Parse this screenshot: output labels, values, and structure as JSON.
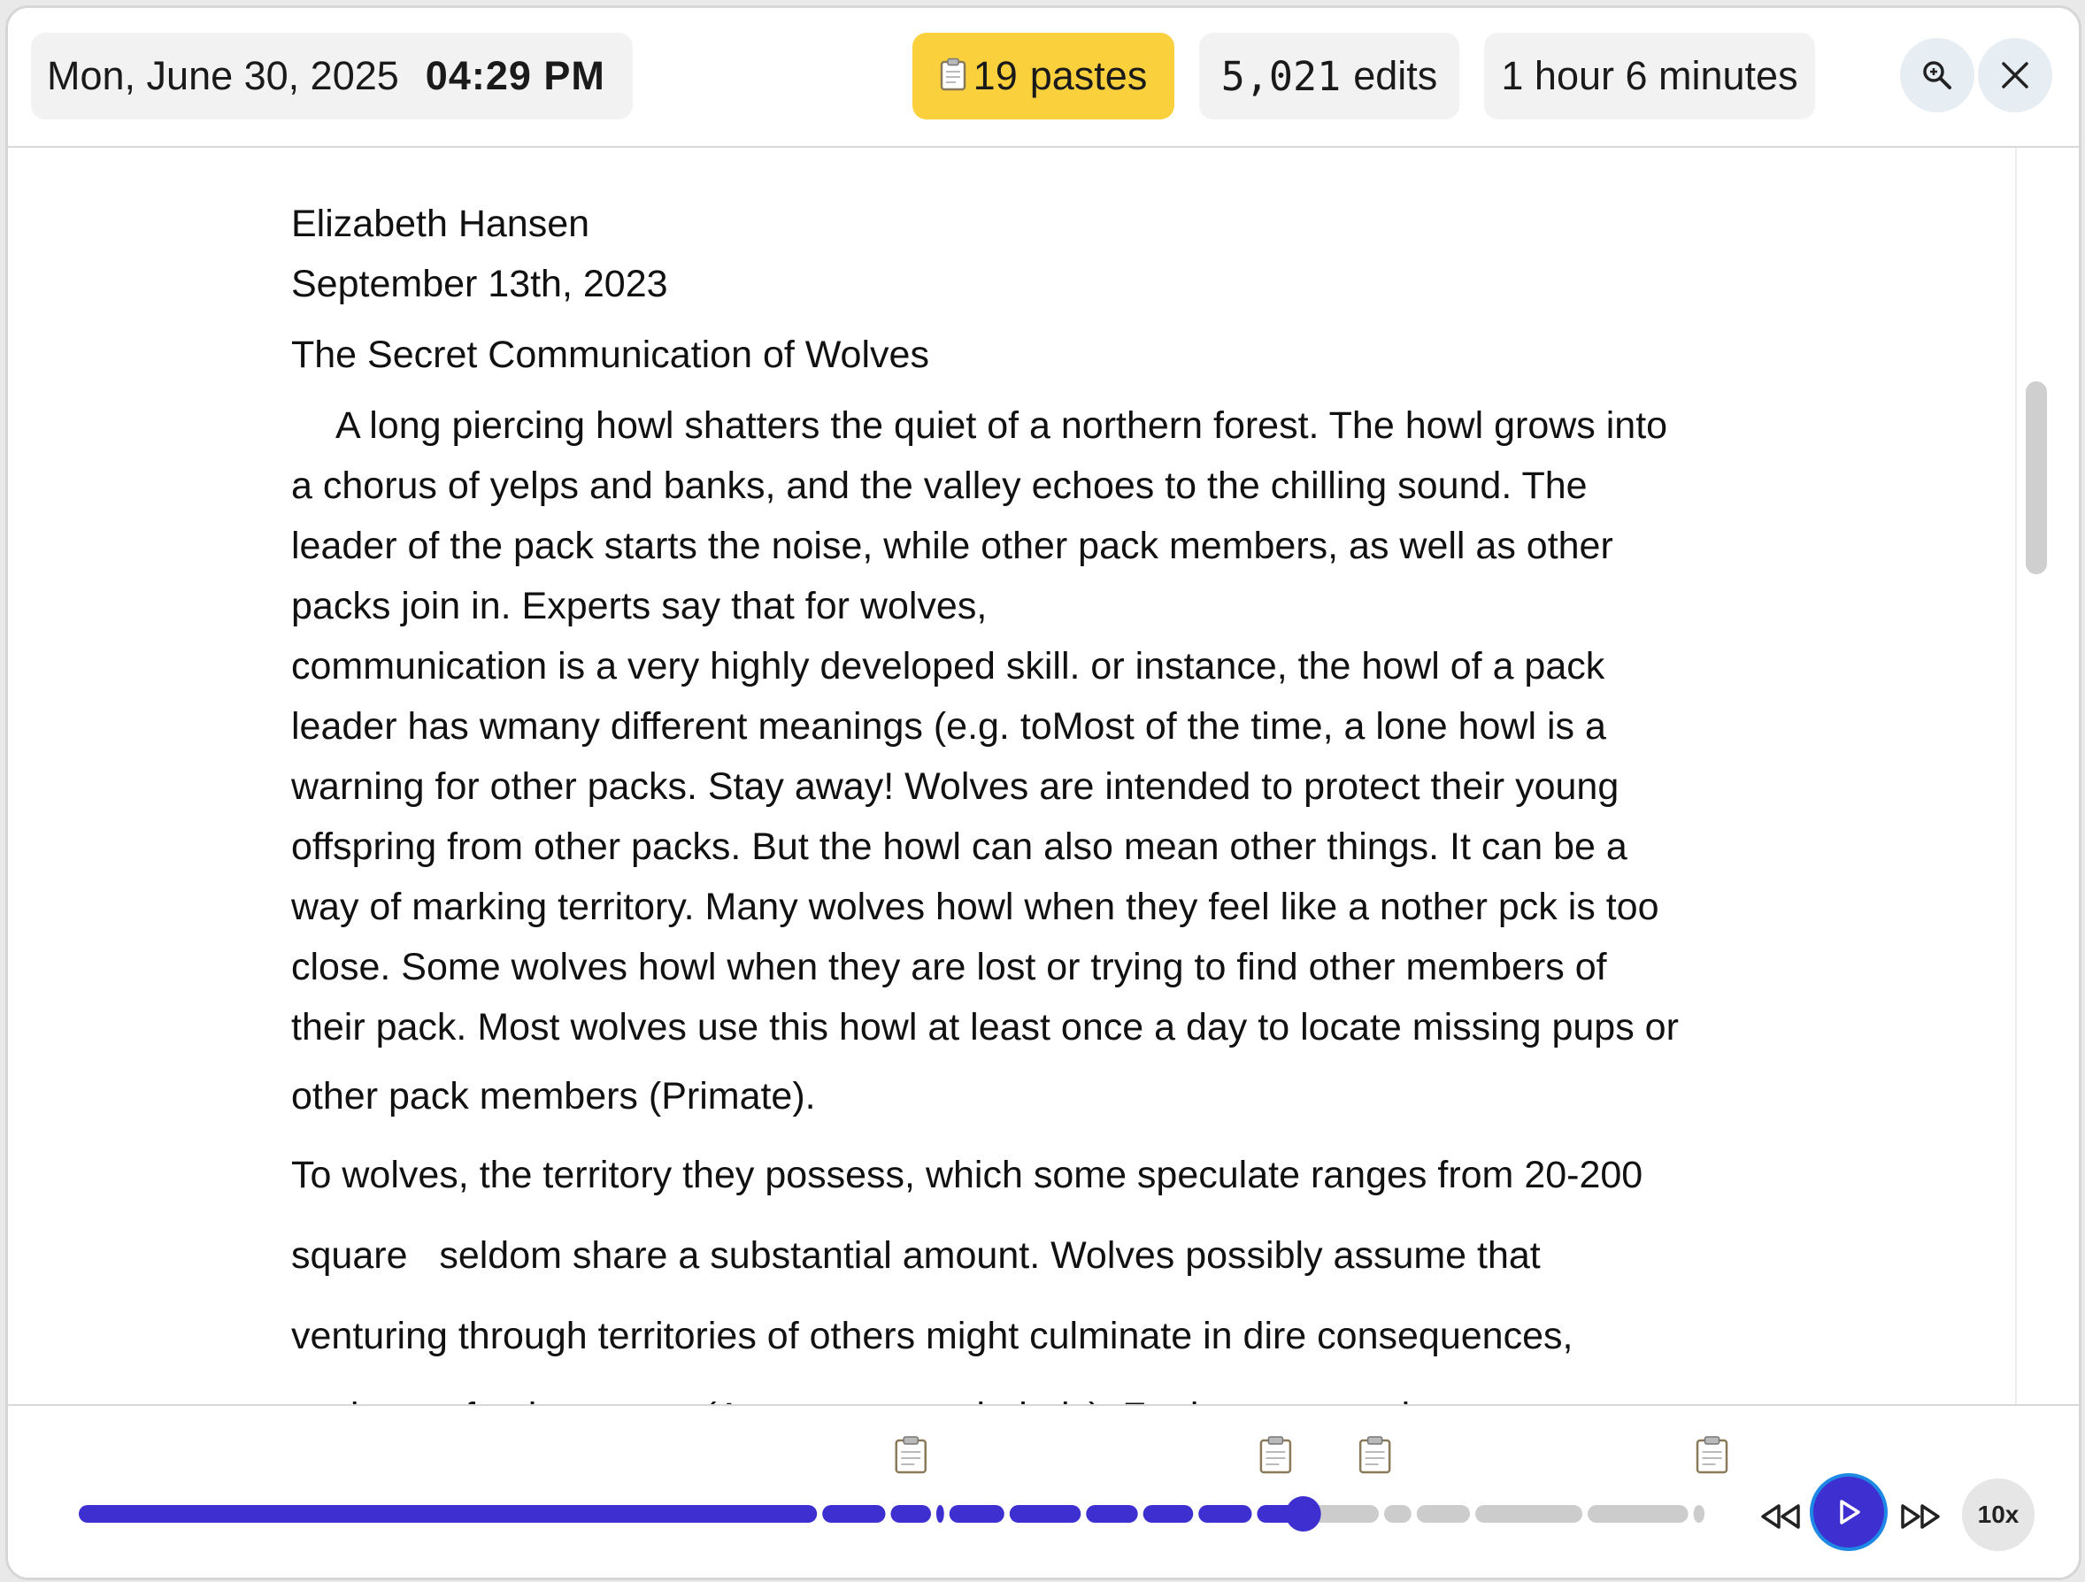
{
  "header": {
    "date": "Mon, June 30, 2025",
    "time": "04:29 PM",
    "pastes_count": "19",
    "pastes_label": "pastes",
    "edits_count": "5,021",
    "edits_label": "edits",
    "duration": "1 hour 6 minutes",
    "search_icon": "zoom-search-icon",
    "close_icon": "close-icon"
  },
  "document": {
    "author": "Elizabeth Hansen",
    "date": "September 13th, 2023",
    "title": "The Secret Communication of Wolves",
    "paragraph1": [
      "A long piercing howl shatters the quiet of a northern forest. The howl grows into",
      "a chorus of yelps and banks, and the valley echoes to the chilling sound. The",
      "leader of the pack starts the noise, while other pack members, as well as other",
      "packs join in. Experts say that for wolves,",
      "communication is a very highly developed skill. or instance, the howl of a pack",
      "leader has wmany different meanings (e.g. toMost of the time, a lone howl is a",
      "warning for other packs. Stay away! Wolves are intended to protect their young",
      "offspring from other packs. But the howl can also mean other things. It can be a",
      "way of marking territory. Many wolves howl when they feel like a nother pck is too",
      "close. Some wolves howl when they are lost or trying to find other members of",
      "their pack. Most wolves use this howl at least once a day to locate missing pups or",
      "other pack members (Primate)."
    ],
    "paragraph2": [
      "To wolves, the territory they possess, which some speculate ranges from 20-200",
      "square   seldom share a substantial amount. Wolves possibly assume that",
      "venturing through territories of others might culminate in dire consequences,",
      "such as a fatal outcome (Anonymous, scholarly). Furthermore, wolves"
    ]
  },
  "playback": {
    "progress": 0.752,
    "paste_marker_positions": [
      0.511,
      0.735,
      0.796,
      1.003
    ],
    "segment_breaks": [
      0.455,
      0.497,
      0.525,
      0.533,
      0.57,
      0.617,
      0.652,
      0.686,
      0.722,
      0.75,
      0.8,
      0.82,
      0.856,
      0.925,
      0.99
    ],
    "played_color": "#3e2fd1",
    "unplayed_color": "#cccccc",
    "rewind_icon": "rewind-icon",
    "play_icon": "play-icon",
    "fast_forward_icon": "fast-forward-icon",
    "speed": "10x"
  }
}
